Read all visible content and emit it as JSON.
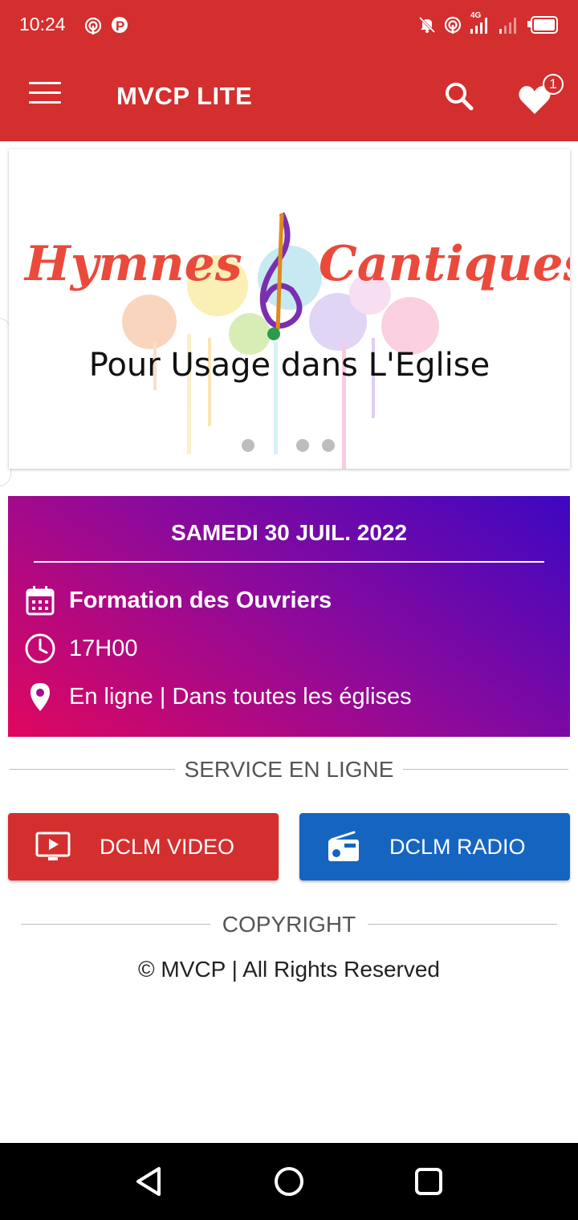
{
  "status_bar": {
    "time": "10:24",
    "left_icons": [
      "hotspot-icon",
      "parking-p-icon"
    ],
    "right_icons": [
      "mute-icon",
      "hotspot-icon",
      "signal-4g-icon",
      "signal-weak-icon",
      "battery-icon"
    ],
    "network": "4G"
  },
  "app_bar": {
    "title": "MVCP LITE",
    "favorites_count": "1",
    "color": "#d32f2f"
  },
  "banner": {
    "title_left": "Hymnes",
    "title_right": "Cantiques",
    "subtitle": "Pour Usage dans L'Eglise",
    "dot_count": 3
  },
  "event": {
    "date": "SAMEDI 30 JUIL. 2022",
    "title": "Formation des Ouvriers",
    "time": "17H00",
    "location": "En ligne | Dans toutes les églises"
  },
  "service": {
    "heading": "SERVICE EN LIGNE",
    "video_label": "DCLM VIDEO",
    "radio_label": "DCLM RADIO",
    "video_color": "#d32f2f",
    "radio_color": "#1565c0"
  },
  "footer": {
    "heading": "COPYRIGHT",
    "text": "© MVCP | All Rights Reserved"
  }
}
